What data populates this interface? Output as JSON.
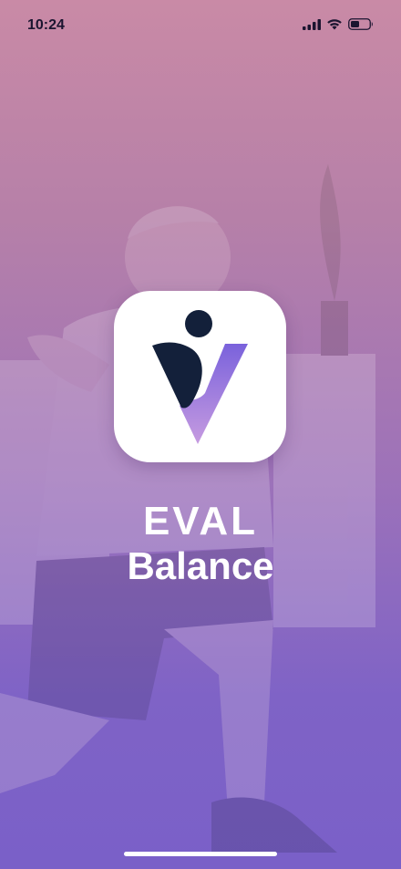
{
  "status_bar": {
    "time": "10:24"
  },
  "icons": {
    "signal": "cellular-signal-icon",
    "wifi": "wifi-icon",
    "battery": "battery-icon"
  },
  "brand": {
    "name_line1": "EVAL",
    "name_line2": "Balance"
  },
  "colors": {
    "gradient_top": "#c98aa6",
    "gradient_bottom": "#7a60c8",
    "logo_navy": "#13203a",
    "logo_purple": "#7a62dc"
  }
}
